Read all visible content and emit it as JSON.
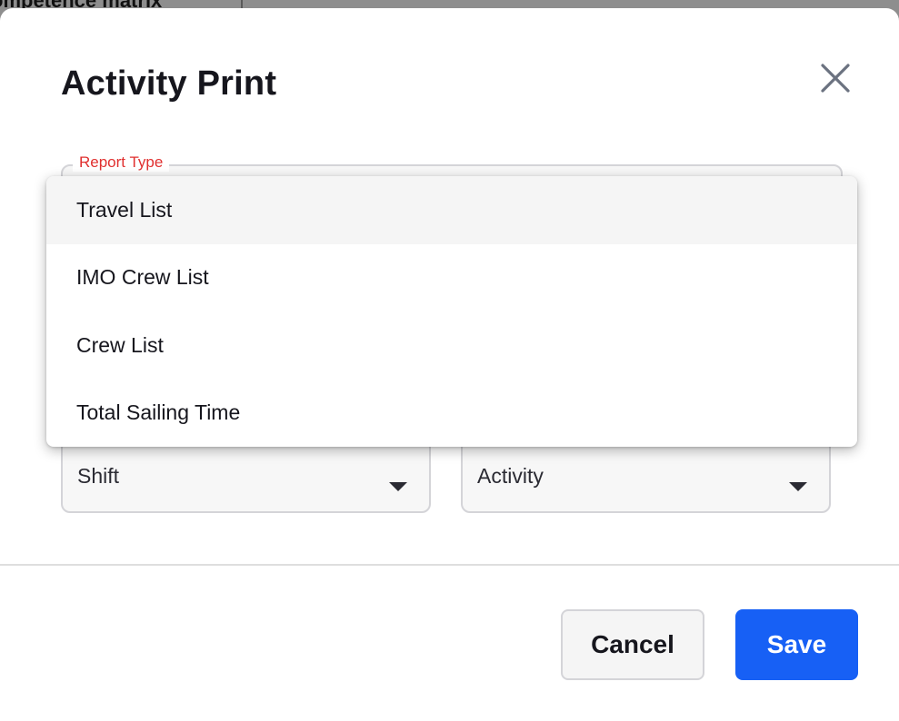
{
  "background": {
    "partial_text": "ompetence matrix"
  },
  "modal": {
    "title": "Activity Print",
    "close_icon": "close-icon"
  },
  "form": {
    "report_type": {
      "label": "Report Type",
      "options": [
        "Travel List",
        "IMO Crew List",
        "Crew List",
        "Total Sailing Time"
      ],
      "highlighted_option": "Travel List"
    },
    "shift": {
      "value": "Shift"
    },
    "activity": {
      "value": "Activity"
    }
  },
  "footer": {
    "cancel_label": "Cancel",
    "save_label": "Save"
  },
  "colors": {
    "accent": "#1760f5",
    "label_error": "#e0302f",
    "text": "#16161d"
  }
}
